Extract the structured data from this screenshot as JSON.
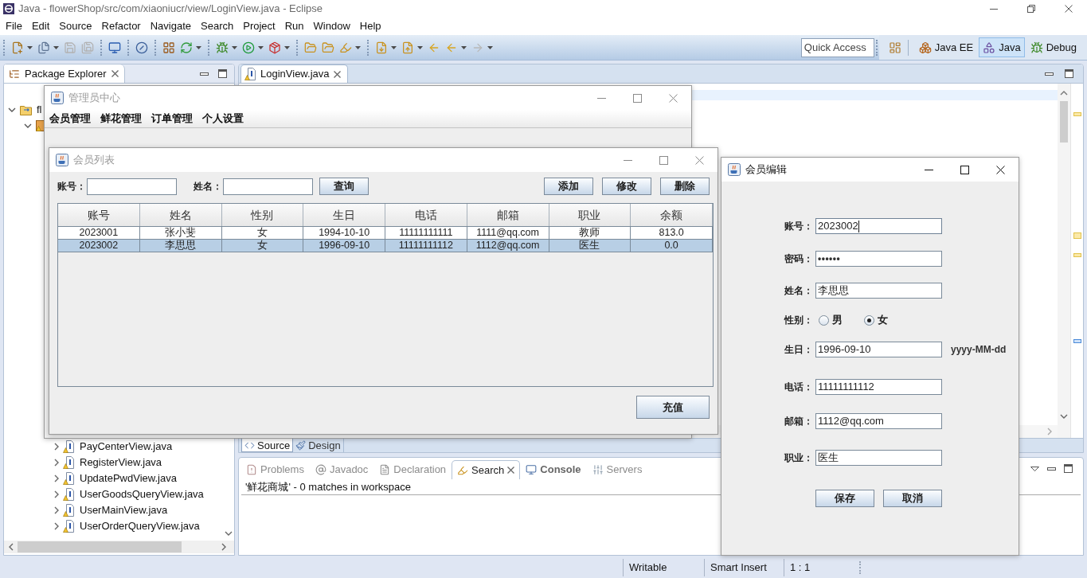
{
  "eclipse": {
    "title": "Java - flowerShop/src/com/xiaoniucr/view/LoginView.java - Eclipse",
    "menu": [
      "File",
      "Edit",
      "Source",
      "Refactor",
      "Navigate",
      "Search",
      "Project",
      "Run",
      "Window",
      "Help"
    ],
    "quick_access": {
      "placeholder": "Quick Access"
    },
    "perspectives": [
      {
        "label": "Java EE",
        "selected": false
      },
      {
        "label": "Java",
        "selected": true
      },
      {
        "label": "Debug",
        "selected": false
      }
    ],
    "package_explorer": {
      "title": "Package Explorer",
      "tree": [
        {
          "label": "fl",
          "expanded": true,
          "children": [
            {
              "expanded": true
            }
          ]
        }
      ],
      "items": [
        {
          "label": "PayCenterView.java",
          "expanded": false
        },
        {
          "label": "RegisterView.java",
          "expanded": false
        },
        {
          "label": "UpdatePwdView.java",
          "expanded": false
        },
        {
          "label": "UserGoodsQueryView.java",
          "expanded": false
        },
        {
          "label": "UserMainView.java",
          "expanded": false
        },
        {
          "label": "UserOrderQueryView.java",
          "expanded": false
        }
      ]
    },
    "editor": {
      "tabs": [
        {
          "label": "LoginView.java",
          "selected": true
        }
      ],
      "mode_tabs": [
        {
          "label": "Source",
          "selected": true
        },
        {
          "label": "Design",
          "selected": false
        }
      ]
    },
    "bottom_panel": {
      "tabs": [
        {
          "label": "Problems",
          "selected": false,
          "updated": false
        },
        {
          "label": "Javadoc",
          "selected": false,
          "updated": false
        },
        {
          "label": "Declaration",
          "selected": false,
          "updated": false
        },
        {
          "label": "Search",
          "selected": true,
          "updated": false
        },
        {
          "label": "Console",
          "selected": false,
          "updated": true
        },
        {
          "label": "Servers",
          "selected": false,
          "updated": false
        }
      ],
      "search_result": "'鲜花商城' - 0 matches in workspace"
    },
    "status_bar": [
      "Writable",
      "Smart Insert",
      "1 : 1"
    ]
  },
  "windows": [
    {
      "kind": "menu_frame",
      "title": "管理员中心",
      "active": false,
      "menu": [
        "会员管理",
        "鲜花管理",
        "订单管理",
        "个人设置"
      ]
    },
    {
      "kind": "member_list",
      "title": "会员列表",
      "active": false,
      "search": [
        {
          "label": "账号："
        },
        {
          "label": "姓名："
        }
      ],
      "search_button": "查询",
      "actions": [
        "添加",
        "修改",
        "删除"
      ],
      "table": {
        "columns": [
          "账号",
          "姓名",
          "性别",
          "生日",
          "电话",
          "邮箱",
          "职业",
          "余额"
        ],
        "rows": [
          {
            "cells": [
              "2023001",
              "张小斐",
              "女",
              "1994-10-10",
              "11111111111",
              "1111@qq.com",
              "教师",
              "813.0"
            ],
            "selected": false
          },
          {
            "cells": [
              "2023002",
              "李思思",
              "女",
              "1996-09-10",
              "11111111112",
              "1112@qq.com",
              "医生",
              "0.0"
            ],
            "selected": true
          }
        ]
      },
      "footer_button": "充值"
    },
    {
      "kind": "member_edit",
      "title": "会员编辑",
      "active": true,
      "fields": [
        {
          "kind": "text",
          "label": "账号：",
          "value": "2023002",
          "focused": true
        },
        {
          "kind": "password",
          "label": "密码：",
          "value": "••••••",
          "focused": false
        },
        {
          "kind": "text",
          "label": "姓名：",
          "value": "李思思",
          "focused": false
        },
        {
          "kind": "radio",
          "label": "性别：",
          "options": [
            {
              "label": "男",
              "selected": false
            },
            {
              "label": "女",
              "selected": true
            }
          ]
        },
        {
          "kind": "text",
          "label": "生日：",
          "value": "1996-09-10",
          "hint": "yyyy-MM-dd",
          "focused": false
        },
        {
          "kind": "text",
          "label": "电话：",
          "value": "11111111112",
          "focused": false
        },
        {
          "kind": "text",
          "label": "邮箱：",
          "value": "1112@qq.com",
          "focused": false
        },
        {
          "kind": "text",
          "label": "职业：",
          "value": "医生",
          "focused": false
        }
      ],
      "buttons": [
        "保存",
        "取消"
      ]
    }
  ]
}
